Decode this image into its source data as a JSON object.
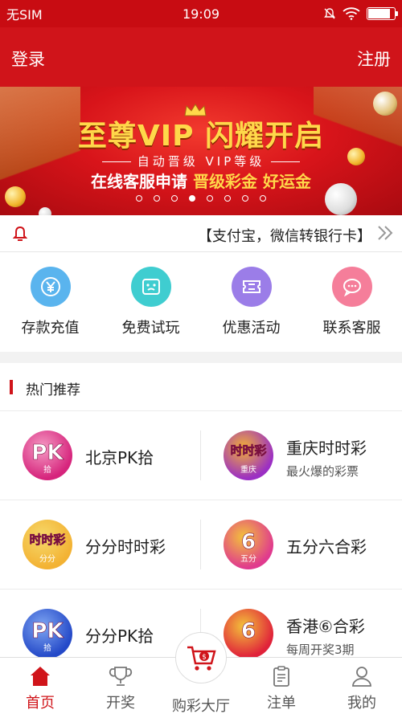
{
  "status_bar": {
    "carrier": "无SIM",
    "time": "19:09",
    "battery_level": 0.9
  },
  "header": {
    "login": "登录",
    "register": "注册"
  },
  "banner": {
    "title": "至尊VIP 闪耀开启",
    "subtitle": "自动晋级 VIP等级",
    "promo_prefix": "在线客服申请",
    "promo_highlight1": "晋级彩金",
    "promo_highlight2": "好运金",
    "slide_count": 8,
    "active_slide": 3
  },
  "notice": {
    "text": "【支付宝，微信转银行卡】"
  },
  "quick_entries": [
    {
      "label": "存款充值",
      "icon": "yen-icon",
      "color": "#5ab4ee"
    },
    {
      "label": "免费试玩",
      "icon": "controller-icon",
      "color": "#3fcdd0"
    },
    {
      "label": "优惠活动",
      "icon": "ticket-icon",
      "color": "#9b7de8"
    },
    {
      "label": "联系客服",
      "icon": "chat-icon",
      "color": "#f57e9a"
    }
  ],
  "section": {
    "title": "热门推荐"
  },
  "games": [
    {
      "name": "北京PK拾",
      "desc": "",
      "logo_text": "PK",
      "logo_sub": "拾",
      "logo_color": "#d6247c",
      "logo_color2": "#f59bc4"
    },
    {
      "name": "重庆时时彩",
      "desc": "最火爆的彩票",
      "logo_text": "时时彩",
      "logo_sub": "重庆",
      "logo_color": "#9b2fc4",
      "logo_color2": "#f3b233"
    },
    {
      "name": "分分时时彩",
      "desc": "",
      "logo_text": "时时彩",
      "logo_sub": "分分",
      "logo_color": "#f3b233",
      "logo_color2": "#f6d96b"
    },
    {
      "name": "五分六合彩",
      "desc": "",
      "logo_text": "6",
      "logo_sub": "五分",
      "logo_color": "#e03a8e",
      "logo_color2": "#f3c23a"
    },
    {
      "name": "分分PK拾",
      "desc": "",
      "logo_text": "PK",
      "logo_sub": "拾",
      "logo_color": "#2449c8",
      "logo_color2": "#7fa6f2"
    },
    {
      "name": "香港⑥合彩",
      "desc": "每周开奖3期",
      "logo_text": "6",
      "logo_sub": "",
      "logo_color": "#e0223a",
      "logo_color2": "#f3c23a"
    }
  ],
  "tabbar": [
    {
      "label": "首页",
      "icon": "home-icon",
      "active": true
    },
    {
      "label": "开奖",
      "icon": "trophy-icon",
      "active": false
    },
    {
      "label": "购彩大厅",
      "icon": "cart-icon",
      "active": false
    },
    {
      "label": "注单",
      "icon": "clipboard-icon",
      "active": false
    },
    {
      "label": "我的",
      "icon": "user-icon",
      "active": false
    }
  ],
  "colors": {
    "brand": "#d0141a",
    "gold": "#ffd84a"
  }
}
